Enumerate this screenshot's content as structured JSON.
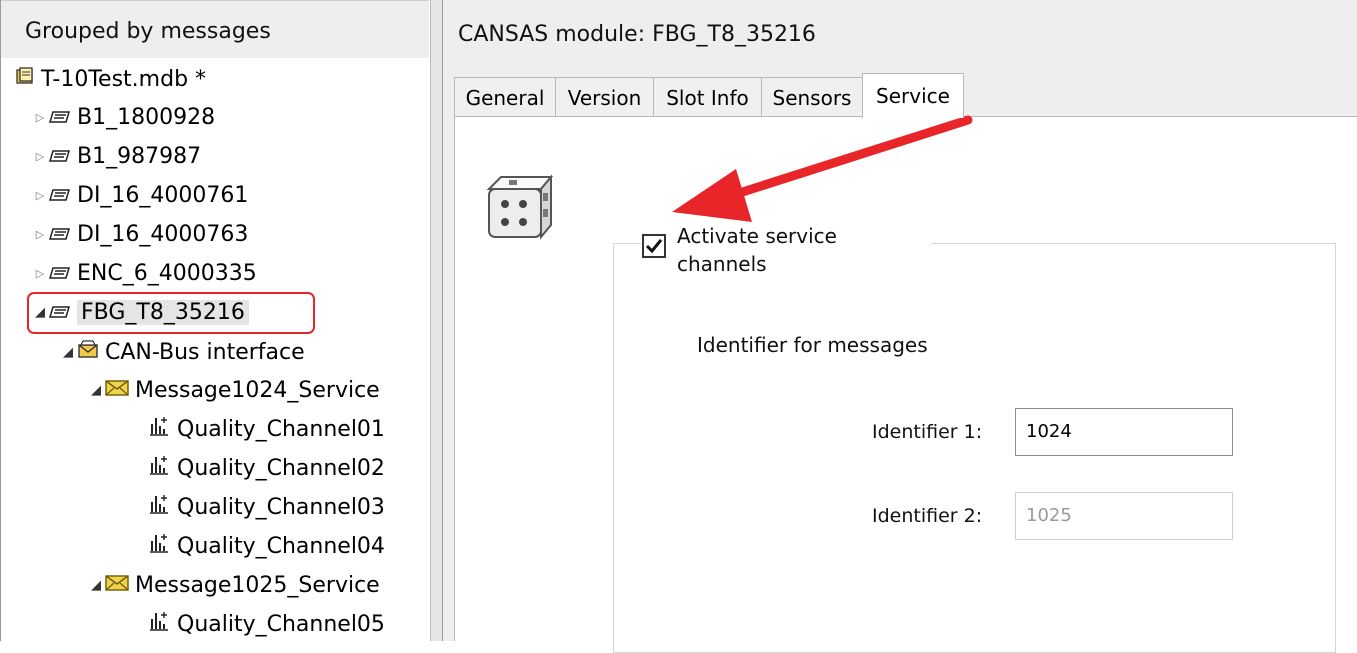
{
  "tree": {
    "header": "Grouped by messages",
    "root": "T-10Test.mdb *",
    "modules": [
      "B1_1800928",
      "B1_987987",
      "DI_16_4000761",
      "DI_16_4000763",
      "ENC_6_4000335"
    ],
    "selected_module": "FBG_T8_35216",
    "interface": "CAN-Bus interface",
    "message1": "Message1024_Service",
    "message1_channels": [
      "Quality_Channel01",
      "Quality_Channel02",
      "Quality_Channel03",
      "Quality_Channel04"
    ],
    "message2": "Message1025_Service",
    "message2_channels": [
      "Quality_Channel05"
    ]
  },
  "module_title": "CANSAS module: FBG_T8_35216",
  "tabs": [
    "General",
    "Version",
    "Slot Info",
    "Sensors",
    "Service"
  ],
  "active_tab": "Service",
  "service": {
    "checkbox_label": "Activate service channels",
    "checkbox_checked": true,
    "identifier_heading": "Identifier for messages",
    "identifier1_label": "Identifier 1:",
    "identifier1_value": "1024",
    "identifier2_label": "Identifier 2:",
    "identifier2_value": "1025"
  },
  "colors": {
    "highlight_box": "#e8262a",
    "annotation_arrow": "#e8262a",
    "message_icon": "#d9a400"
  }
}
